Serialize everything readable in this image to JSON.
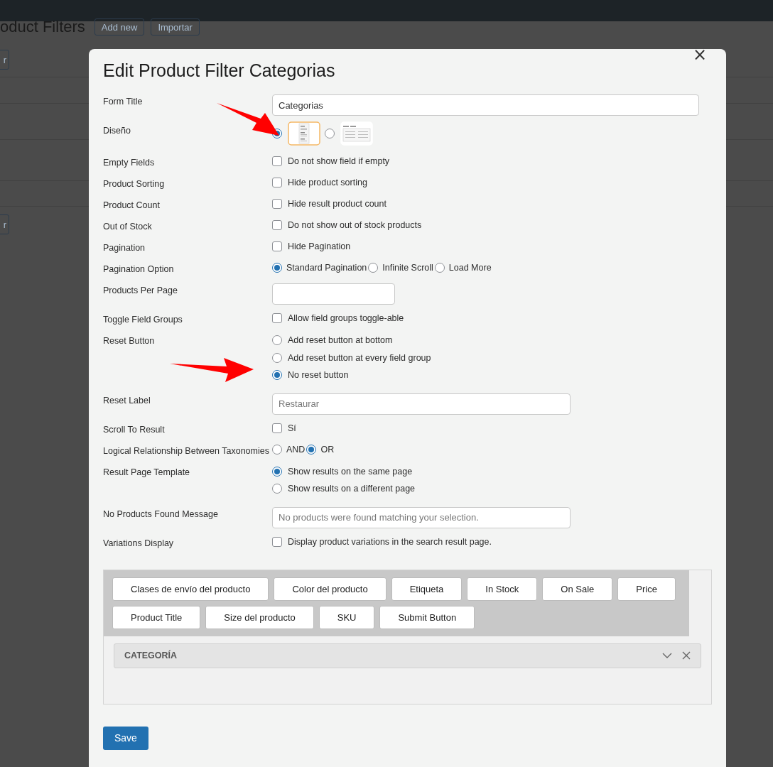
{
  "page": {
    "title": "oduct Filters",
    "buttons": [
      "Add new",
      "Importar"
    ],
    "side_buttons": [
      "r",
      "r"
    ]
  },
  "modal": {
    "title": "Edit Product Filter Categorias",
    "close": "×",
    "fields": [
      {
        "label": "Form Title",
        "kind": "text",
        "value": "Categorias"
      },
      {
        "label": "Diseño",
        "kind": "layout",
        "options": [
          {
            "selected": true
          },
          {
            "selected": false
          }
        ]
      },
      {
        "label": "Empty Fields",
        "kind": "checkbox",
        "text": "Do not show field if empty",
        "checked": false
      },
      {
        "label": "Product Sorting",
        "kind": "checkbox",
        "text": "Hide product sorting",
        "checked": false
      },
      {
        "label": "Product Count",
        "kind": "checkbox",
        "text": "Hide result product count",
        "checked": false
      },
      {
        "label": "Out of Stock",
        "kind": "checkbox",
        "text": "Do not show out of stock products",
        "checked": false
      },
      {
        "label": "Pagination",
        "kind": "checkbox",
        "text": "Hide Pagination",
        "checked": false
      },
      {
        "label": "Pagination Option",
        "kind": "inline",
        "options": [
          {
            "text": "Standard Pagination",
            "selected": true
          },
          {
            "text": "Infinite Scroll",
            "selected": false
          },
          {
            "text": "Load More",
            "selected": false
          }
        ]
      },
      {
        "label": "Products Per Page",
        "kind": "text"
      },
      {
        "label": "Toggle Field Groups",
        "kind": "checkbox",
        "text": "Allow field groups toggle-able",
        "checked": false
      },
      {
        "label": "Reset Button",
        "kind": "stacked",
        "options": [
          {
            "text": "Add reset button at bottom",
            "selected": false
          },
          {
            "text": "Add reset button at every field group",
            "selected": false
          },
          {
            "text": "No reset button",
            "selected": true
          }
        ]
      },
      {
        "label": "Reset Label",
        "kind": "text",
        "placeholder": "Restaurar"
      },
      {
        "label": "Scroll To Result",
        "kind": "checkbox",
        "text": "Sí",
        "checked": false
      },
      {
        "label": "Logical Relationship Between Taxonomies",
        "kind": "inline",
        "options": [
          {
            "text": "AND",
            "selected": false
          },
          {
            "text": "OR",
            "selected": true
          }
        ]
      },
      {
        "label": "Result Page Template",
        "kind": "stacked",
        "options": [
          {
            "text": "Show results on the same page",
            "selected": true
          },
          {
            "text": "Show results on a different page",
            "selected": false
          }
        ]
      },
      {
        "label": "No Products Found Message",
        "kind": "text",
        "placeholder": "No products were found matching your selection."
      },
      {
        "label": "Variations Display",
        "kind": "checkbox",
        "text": "Display product variations in the search result page.",
        "checked": false
      }
    ],
    "builder": {
      "chips": [
        "Clases de envío del producto",
        "Color del producto",
        "Etiqueta",
        "In Stock",
        "On Sale",
        "Price",
        "Product Title",
        "Size del producto",
        "SKU",
        "Submit Button"
      ],
      "groups": [
        {
          "title": "CATEGORÍA"
        }
      ]
    },
    "save": "Save"
  }
}
